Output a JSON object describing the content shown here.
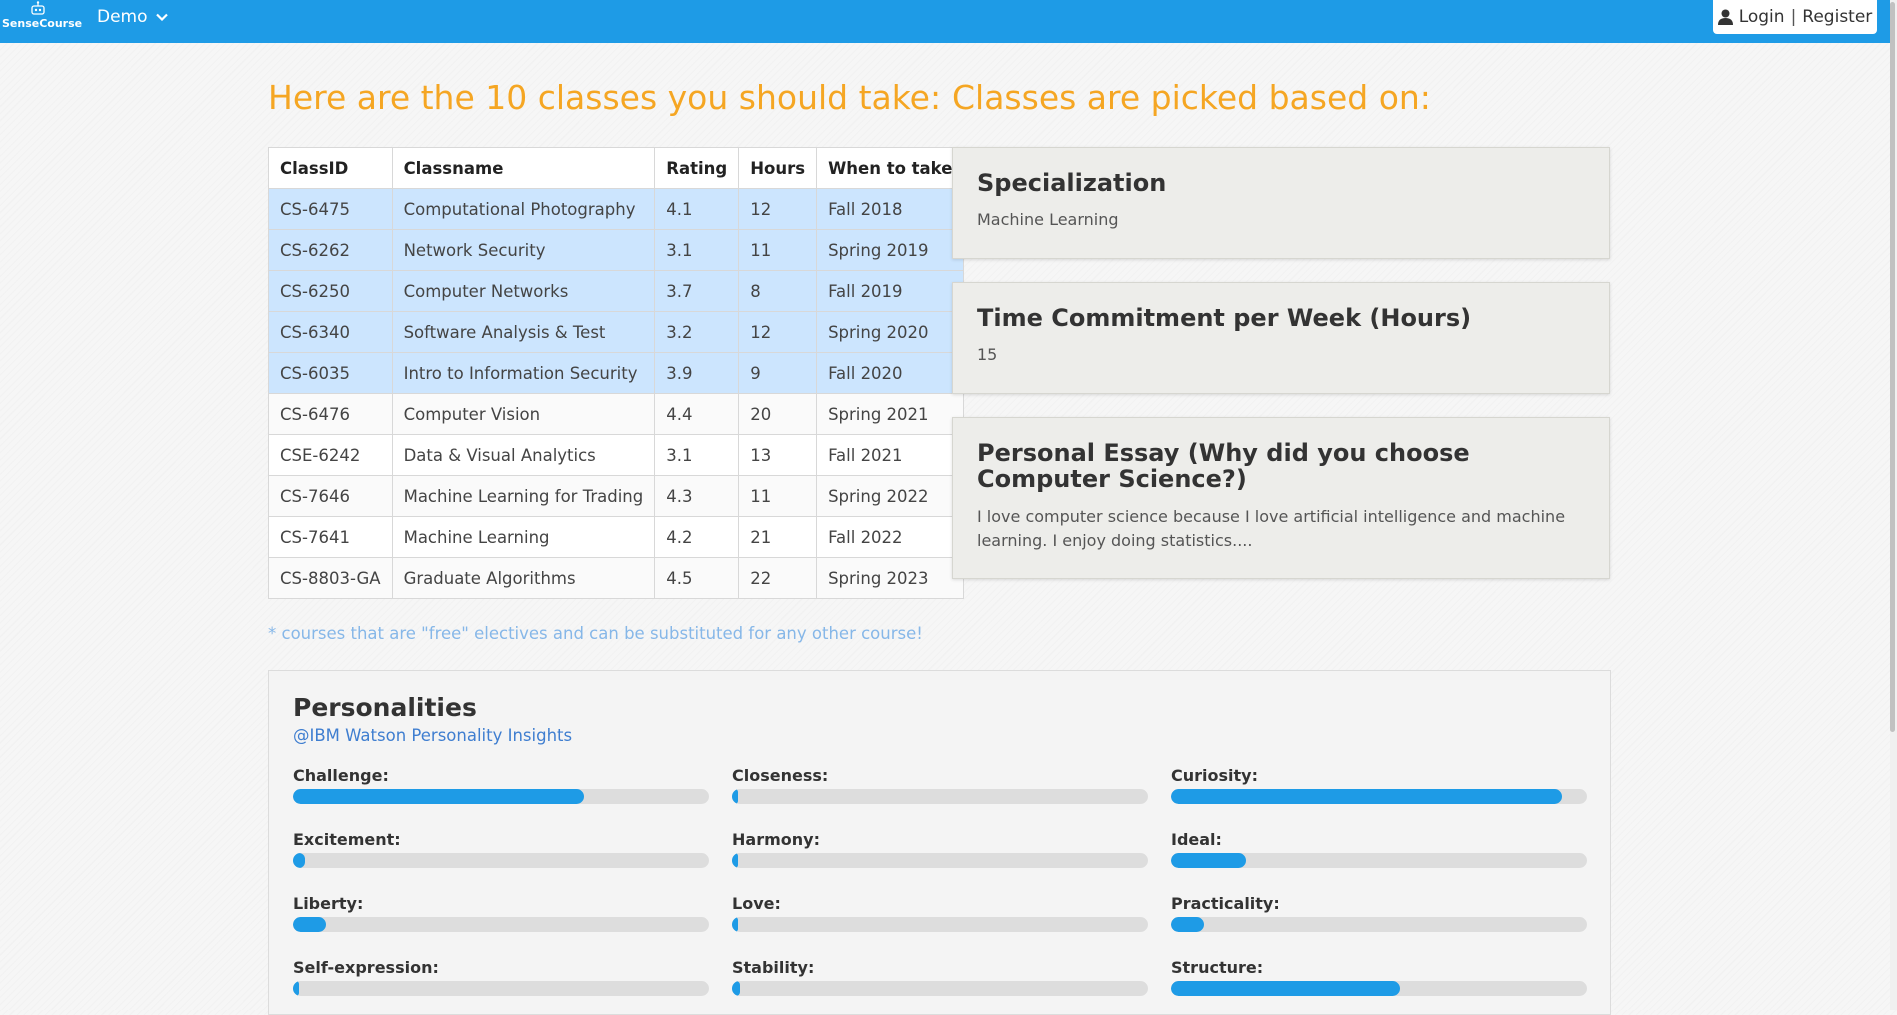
{
  "nav": {
    "brand": "SenseCourse",
    "demo_label": "Demo",
    "login_label": "Login",
    "separator": "|",
    "register_label": "Register"
  },
  "left_heading": "Here are the 10 classes you should take:",
  "right_heading": "Classes are picked based on:",
  "table": {
    "headers": [
      "ClassID",
      "Classname",
      "Rating",
      "Hours",
      "When to take"
    ],
    "rows": [
      [
        "CS-6475",
        "Computational Photography",
        "4.1",
        "12",
        "Fall 2018"
      ],
      [
        "CS-6262",
        "Network Security",
        "3.1",
        "11",
        "Spring 2019"
      ],
      [
        "CS-6250",
        "Computer Networks",
        "3.7",
        "8",
        "Fall 2019"
      ],
      [
        "CS-6340",
        "Software Analysis & Test",
        "3.2",
        "12",
        "Spring 2020"
      ],
      [
        "CS-6035",
        "Intro to Information Security",
        "3.9",
        "9",
        "Fall 2020"
      ],
      [
        "CS-6476",
        "Computer Vision",
        "4.4",
        "20",
        "Spring 2021"
      ],
      [
        "CSE-6242",
        "Data & Visual Analytics",
        "3.1",
        "13",
        "Fall 2021"
      ],
      [
        "CS-7646",
        "Machine Learning for Trading",
        "4.3",
        "11",
        "Spring 2022"
      ],
      [
        "CS-7641",
        "Machine Learning",
        "4.2",
        "21",
        "Fall 2022"
      ],
      [
        "CS-8803-GA",
        "Graduate Algorithms",
        "4.5",
        "22",
        "Spring 2023"
      ]
    ]
  },
  "note": "* courses that are \"free\" electives and can be substituted for any other course!",
  "criteria": {
    "specialization": {
      "title": "Specialization",
      "value": "Machine Learning"
    },
    "time": {
      "title": "Time Commitment per Week (Hours)",
      "value": "15"
    },
    "essay": {
      "title": "Personal Essay (Why did you choose Computer Science?)",
      "value": "I love computer science because I love artificial intelligence and machine learning. I enjoy doing statistics...."
    }
  },
  "personalities": {
    "title": "Personalities",
    "source_link": "@IBM Watson Personality Insights",
    "bar_color": "#1e9be6",
    "traits": [
      {
        "label": "Challenge:",
        "level": 0.7
      },
      {
        "label": "Closeness:",
        "level": 0.005
      },
      {
        "label": "Curiosity:",
        "level": 0.94
      },
      {
        "label": "Excitement:",
        "level": 0.03
      },
      {
        "label": "Harmony:",
        "level": 0.01
      },
      {
        "label": "Ideal:",
        "level": 0.18
      },
      {
        "label": "Liberty:",
        "level": 0.08
      },
      {
        "label": "Love:",
        "level": 0.01
      },
      {
        "label": "Practicality:",
        "level": 0.08
      },
      {
        "label": "Self-expression:",
        "level": 0.005
      },
      {
        "label": "Stability:",
        "level": 0.02
      },
      {
        "label": "Structure:",
        "level": 0.55
      }
    ]
  }
}
